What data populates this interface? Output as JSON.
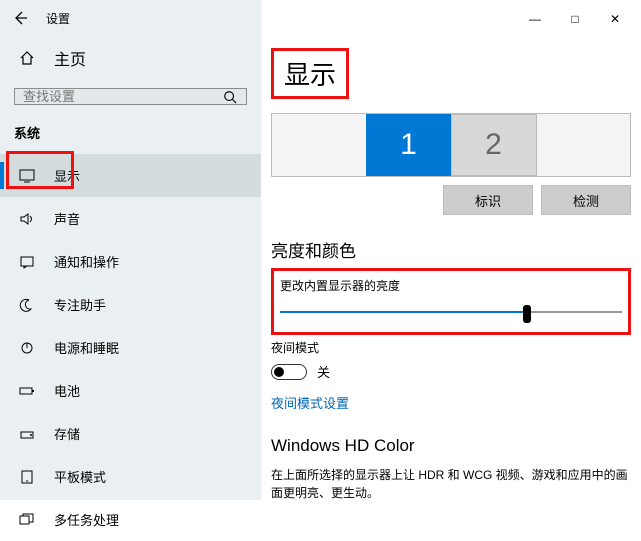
{
  "header": {
    "title": "设置"
  },
  "home_label": "主页",
  "search": {
    "placeholder": "查找设置"
  },
  "category_label": "系统",
  "nav": [
    {
      "label": "显示",
      "icon": "monitor",
      "active": true
    },
    {
      "label": "声音",
      "icon": "sound"
    },
    {
      "label": "通知和操作",
      "icon": "notify"
    },
    {
      "label": "专注助手",
      "icon": "moon"
    },
    {
      "label": "电源和睡眠",
      "icon": "power"
    },
    {
      "label": "电池",
      "icon": "battery"
    },
    {
      "label": "存储",
      "icon": "storage"
    },
    {
      "label": "平板模式",
      "icon": "tablet"
    },
    {
      "label": "多任务处理",
      "icon": "multitask"
    }
  ],
  "main": {
    "title": "显示",
    "monitors": [
      "1",
      "2"
    ],
    "identify_label": "标识",
    "detect_label": "检测",
    "brightness_section": "亮度和颜色",
    "brightness_label": "更改内置显示器的亮度",
    "brightness_value": 72,
    "night_mode_label": "夜间模式",
    "toggle_state": "关",
    "night_link": "夜间模式设置",
    "hd_title": "Windows HD Color",
    "hd_desc": "在上面所选择的显示器上让 HDR 和 WCG 视频、游戏和应用中的画面更明亮、更生动。"
  },
  "window_controls": {
    "min": "—",
    "max": "□",
    "close": "✕"
  }
}
